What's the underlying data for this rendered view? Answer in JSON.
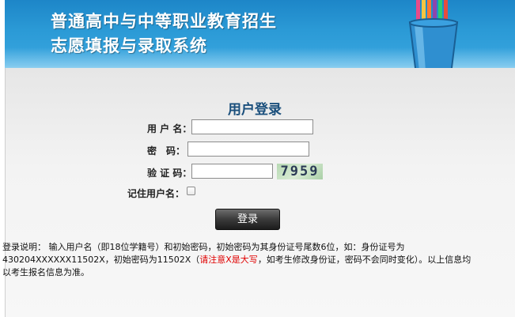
{
  "header": {
    "title_line1": "普通高中与中等职业教育招生",
    "title_line2": "志愿填报与录取系统"
  },
  "login": {
    "title": "用户登录",
    "username_label": "用 户 名：",
    "password_label": "密　码：",
    "captcha_label": "验 证 码：",
    "captcha_text": "7959",
    "remember_label": "记住用户名：",
    "submit_label": "登录"
  },
  "notice": {
    "part1": "登录说明： 输入用户名（即18位学籍号）和初始密码，初始密码为其身份证号尾数6位，如：身份证号为430204XXXXXX11502X，初始密码为11502X（",
    "highlight": "请注意X是大写",
    "part2": "，如考生修改身份证，密码不会同时变化）。以上信息均以考生报名信息为准。"
  },
  "colors": {
    "header_blue": "#2b9ad6",
    "title_blue": "#1a4f7c",
    "warning_red": "#e00000"
  }
}
